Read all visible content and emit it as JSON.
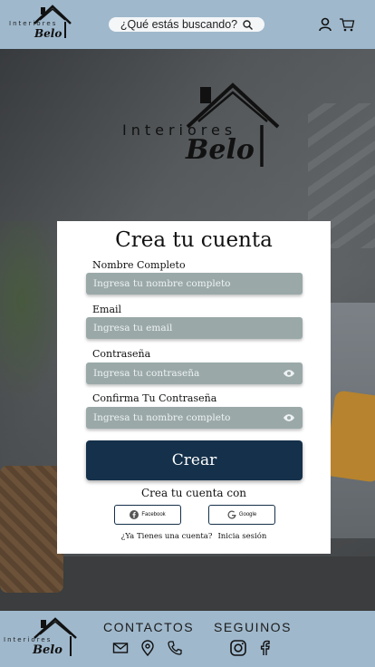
{
  "header": {
    "logo": {
      "word": "Interiores",
      "brand": "Belo"
    },
    "search": {
      "placeholder": "¿Qué estás buscando?",
      "icon": "search-icon"
    },
    "icons": [
      "user-icon",
      "cart-icon"
    ]
  },
  "hero_logo": {
    "word": "Interiores",
    "brand": "Belo"
  },
  "form": {
    "title": "Crea tu cuenta",
    "fields": [
      {
        "label": "Nombre Completo",
        "placeholder": "Ingresa tu nombre completo"
      },
      {
        "label": "Email",
        "placeholder": "Ingresa tu email"
      },
      {
        "label": "Contraseña",
        "placeholder": "Ingresa tu contraseña",
        "icon": "eye-icon"
      },
      {
        "label": "Confirma Tu Contraseña",
        "placeholder": "Ingresa tu nombre completo",
        "icon": "eye-icon"
      }
    ],
    "submit_label": "Crear",
    "social_heading": "Crea tu cuenta con",
    "social": [
      {
        "label": "Facebook",
        "icon": "facebook-icon"
      },
      {
        "label": "Google",
        "icon": "google-icon"
      }
    ],
    "login_prompt": "¿Ya Tienes una cuenta?",
    "login_link": "Inicia sesión"
  },
  "footer": {
    "logo": {
      "word": "Interiores",
      "brand": "Belo"
    },
    "contacts_heading": "CONTACTOS",
    "follow_heading": "SEGUINOS",
    "contact_icons": [
      "mail-icon",
      "location-icon",
      "phone-icon"
    ],
    "social_icons": [
      "instagram-icon",
      "facebook-icon"
    ]
  },
  "colors": {
    "header_bg": "#9fb8cc",
    "button_bg": "#14304a",
    "field_bg": "#9aa8a8"
  }
}
